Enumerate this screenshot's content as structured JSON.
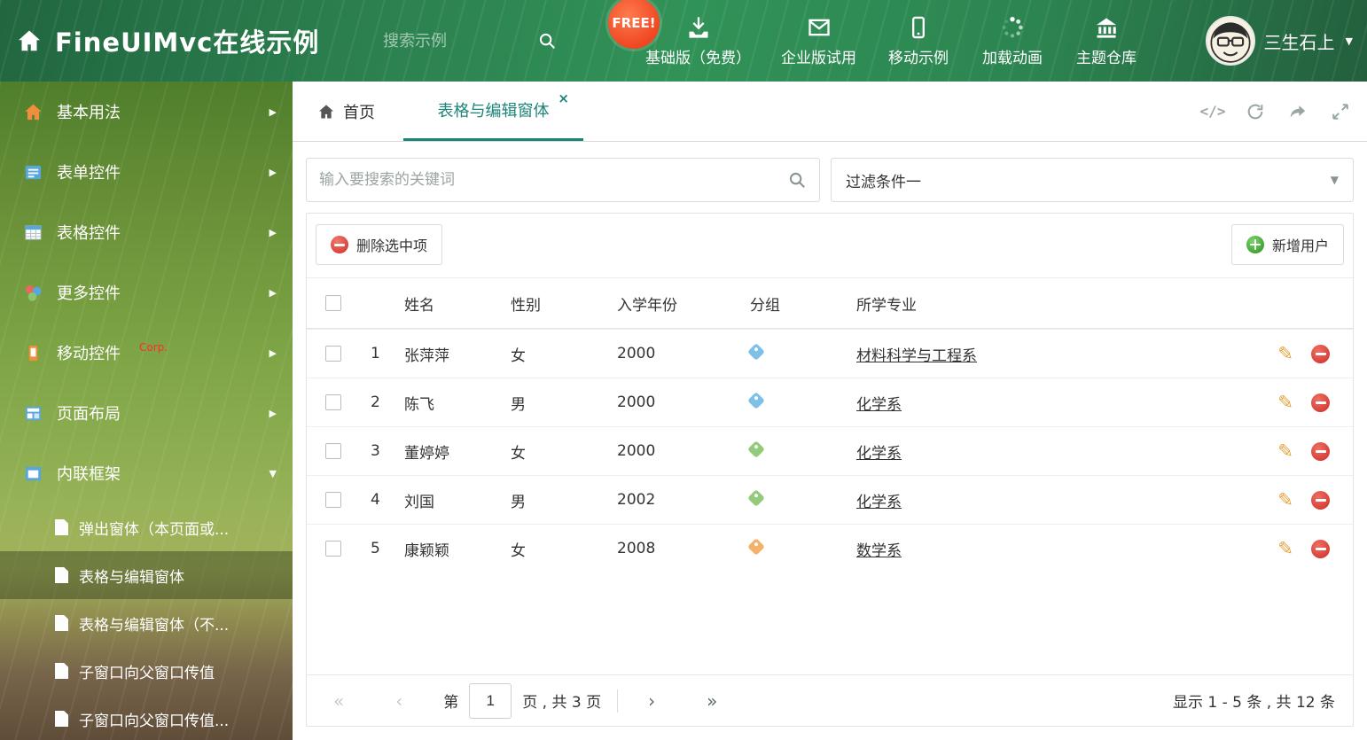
{
  "header": {
    "title": "FineUIMvc在线示例",
    "search_placeholder": "搜索示例",
    "free_badge": "FREE!",
    "nav": [
      {
        "label": "基础版（免费）",
        "icon": "download-icon"
      },
      {
        "label": "企业版试用",
        "icon": "mail-icon"
      },
      {
        "label": "移动示例",
        "icon": "mobile-icon"
      },
      {
        "label": "加载动画",
        "icon": "spinner-icon"
      },
      {
        "label": "主题仓库",
        "icon": "bank-icon"
      }
    ],
    "user_name": "三生石上",
    "user_caret": "▼"
  },
  "sidebar": {
    "items": [
      {
        "label": "基本用法",
        "arrow": "▶"
      },
      {
        "label": "表单控件",
        "arrow": "▶"
      },
      {
        "label": "表格控件",
        "arrow": "▶"
      },
      {
        "label": "更多控件",
        "arrow": "▶"
      },
      {
        "label": "移动控件",
        "badge": "Corp.",
        "arrow": "▶"
      },
      {
        "label": "页面布局",
        "arrow": "▶"
      },
      {
        "label": "内联框架",
        "arrow": "▼"
      }
    ],
    "subitems": [
      {
        "label": "弹出窗体（本页面或..."
      },
      {
        "label": "表格与编辑窗体",
        "active": true
      },
      {
        "label": "表格与编辑窗体（不..."
      },
      {
        "label": "子窗口向父窗口传值"
      },
      {
        "label": "子窗口向父窗口传值..."
      }
    ]
  },
  "tabbar": {
    "home_label": "首页",
    "active_label": "表格与编辑窗体",
    "close_icon": "×",
    "code_icon": "</>"
  },
  "filter": {
    "search_placeholder": "输入要搜索的关键词",
    "dropdown_value": "过滤条件一",
    "dropdown_caret": "▼"
  },
  "toolbar": {
    "delete_label": "删除选中项",
    "add_label": "新增用户"
  },
  "table": {
    "columns": {
      "name": "姓名",
      "gender": "性别",
      "year": "入学年份",
      "group": "分组",
      "major": "所学专业"
    },
    "edit_icon": "✎",
    "rows": [
      {
        "num": "1",
        "name": "张萍萍",
        "gender": "女",
        "year": "2000",
        "tag_color": "#7fc0e8",
        "major": "材料科学与工程系"
      },
      {
        "num": "2",
        "name": "陈飞",
        "gender": "男",
        "year": "2000",
        "tag_color": "#7fc0e8",
        "major": "化学系"
      },
      {
        "num": "3",
        "name": "董婷婷",
        "gender": "女",
        "year": "2000",
        "tag_color": "#93cb7c",
        "major": "化学系"
      },
      {
        "num": "4",
        "name": "刘国",
        "gender": "男",
        "year": "2002",
        "tag_color": "#93cb7c",
        "major": "化学系"
      },
      {
        "num": "5",
        "name": "康颖颖",
        "gender": "女",
        "year": "2008",
        "tag_color": "#f5b06a",
        "major": "数学系"
      }
    ]
  },
  "pagination": {
    "first": "«",
    "prev": "‹",
    "page_before": "第",
    "page_value": "1",
    "page_after": "页 , 共 3 页",
    "next": "›",
    "last": "»",
    "summary": "显示 1 - 5 条 , 共 12 条"
  },
  "colors": {
    "accent_teal": "#1c8579",
    "header_green": "#2b7e4e",
    "tag_blue": "#7fc0e8",
    "tag_green": "#93cb7c",
    "tag_orange": "#f5b06a",
    "delete_red": "#d93f38",
    "add_green": "#3ca132",
    "edit_orange": "#e6a23c"
  }
}
